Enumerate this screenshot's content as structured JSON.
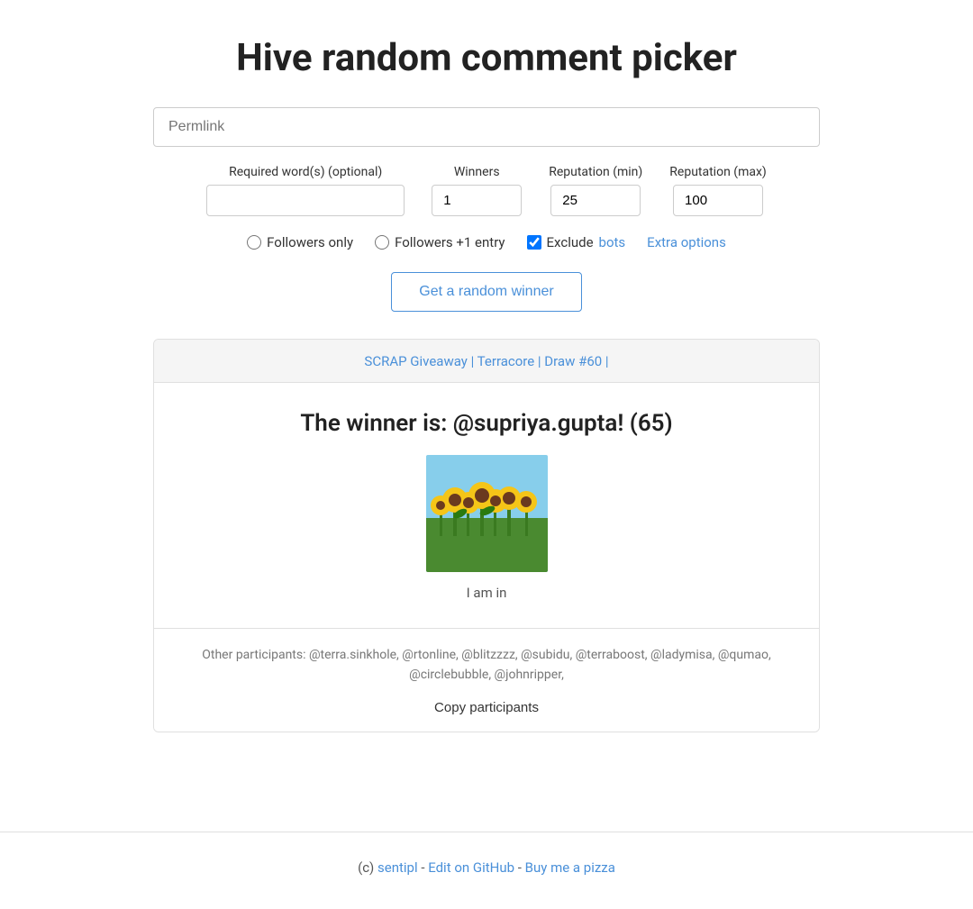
{
  "page": {
    "title": "Hive random comment picker"
  },
  "form": {
    "permlink_placeholder": "Permlink",
    "permlink_value": "",
    "required_words_label": "Required word(s) (optional)",
    "required_words_value": "",
    "winners_label": "Winners",
    "winners_value": "1",
    "reputation_min_label": "Reputation (min)",
    "reputation_min_value": "25",
    "reputation_max_label": "Reputation (max)",
    "reputation_max_value": "100",
    "followers_only_label": "Followers only",
    "followers_plus_label": "Followers +1 entry",
    "exclude_bots_label": "Exclude ",
    "bots_link_label": "bots",
    "extra_options_label": "Extra options",
    "submit_button_label": "Get a random winner"
  },
  "result": {
    "header_link_text": "SCRAP Giveaway | Terracore | Draw #60 |",
    "winner_text": "The winner is: @supriya.gupta! (65)",
    "caption": "I am in",
    "participants_prefix": "Other participants: @terra.sinkhole, @rtonline, @blitzzzz, @subidu, @terraboost, @ladymisa, @qumao, @circlebubble, @johnripper,",
    "copy_participants_label": "Copy participants"
  },
  "footer": {
    "copyright": "(c) ",
    "sentipl_label": "sentipl",
    "separator1": " - ",
    "github_label": "Edit on GitHub",
    "separator2": " - ",
    "pizza_label": "Buy me a pizza"
  }
}
